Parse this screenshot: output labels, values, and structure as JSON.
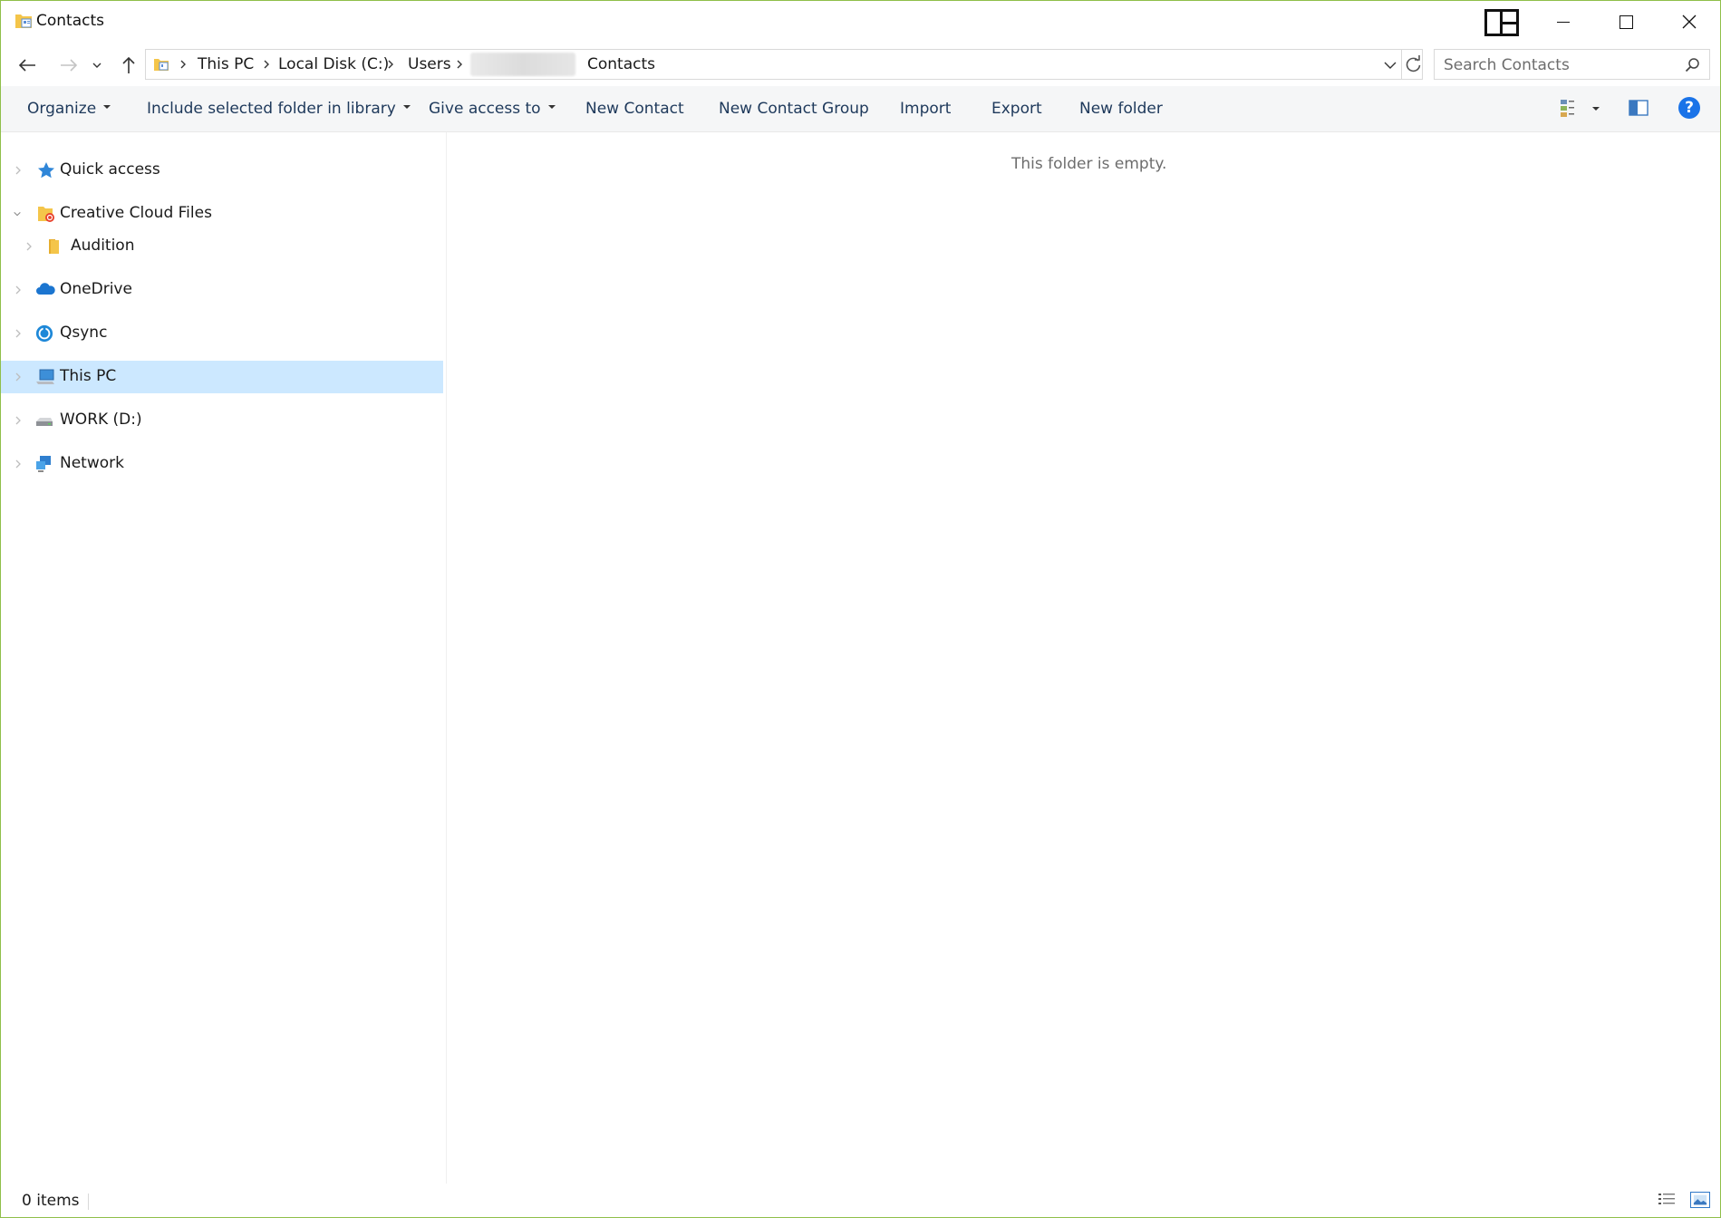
{
  "window": {
    "title": "Contacts"
  },
  "address": {
    "crumbs": [
      "This PC",
      "Local Disk (C:)",
      "Users",
      "Contacts"
    ]
  },
  "search": {
    "placeholder": "Search Contacts"
  },
  "commands": {
    "organize": "Organize",
    "include_library": "Include selected folder in library",
    "give_access": "Give access to",
    "new_contact": "New Contact",
    "new_contact_group": "New Contact Group",
    "import": "Import",
    "export": "Export",
    "new_folder": "New folder"
  },
  "navpane": {
    "items": [
      {
        "label": "Quick access",
        "icon": "star-icon"
      },
      {
        "label": "Creative Cloud Files",
        "icon": "creative-cloud-folder-icon"
      },
      {
        "label": "Audition",
        "icon": "folder-icon"
      },
      {
        "label": "OneDrive",
        "icon": "onedrive-cloud-icon"
      },
      {
        "label": "Qsync",
        "icon": "qsync-icon"
      },
      {
        "label": "This PC",
        "icon": "computer-icon"
      },
      {
        "label": "WORK (D:)",
        "icon": "drive-icon"
      },
      {
        "label": "Network",
        "icon": "network-icon"
      }
    ],
    "selected": "This PC"
  },
  "content": {
    "empty_message": "This folder is empty."
  },
  "status": {
    "item_count": "0 items"
  },
  "colors": {
    "selection": "#cce8ff",
    "command_text": "#1e395b",
    "window_border": "#8fbf4a",
    "help_blue": "#1a73e8"
  }
}
